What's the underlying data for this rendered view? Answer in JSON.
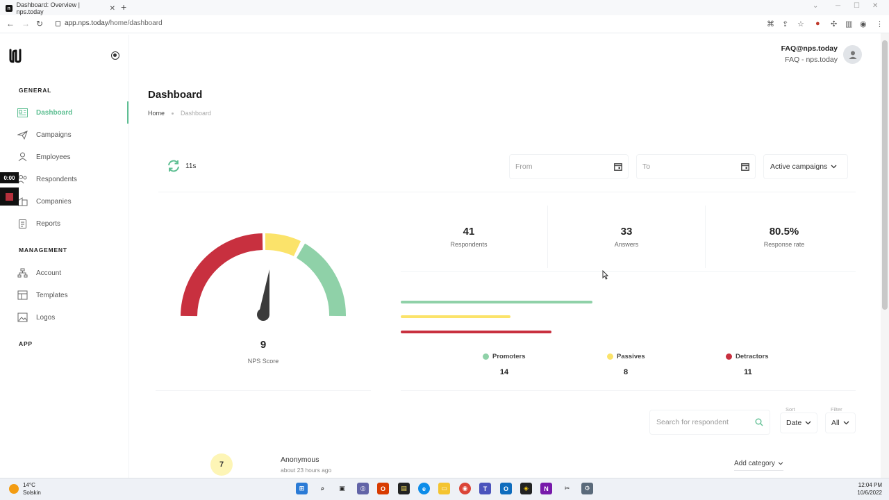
{
  "browser": {
    "tab_title": "Dashboard: Overview | nps.today",
    "url_domain": "app.nps.today",
    "url_path": "/home/dashboard"
  },
  "sidebar": {
    "general_title": "GENERAL",
    "management_title": "MANAGEMENT",
    "app_title": "APP",
    "general_items": [
      {
        "label": "Dashboard",
        "icon": "dashboard-icon",
        "active": true
      },
      {
        "label": "Campaigns",
        "icon": "paper-plane-icon"
      },
      {
        "label": "Employees",
        "icon": "person-icon"
      },
      {
        "label": "Respondents",
        "icon": "respondents-icon"
      },
      {
        "label": "Companies",
        "icon": "building-icon"
      },
      {
        "label": "Reports",
        "icon": "clipboard-icon"
      }
    ],
    "management_items": [
      {
        "label": "Account",
        "icon": "account-tree-icon"
      },
      {
        "label": "Templates",
        "icon": "templates-icon"
      },
      {
        "label": "Logos",
        "icon": "image-icon"
      }
    ]
  },
  "recorder": {
    "time": "0:00"
  },
  "user": {
    "email": "FAQ@nps.today",
    "org": "FAQ - nps.today"
  },
  "page": {
    "title": "Dashboard",
    "breadcrumb": [
      "Home",
      "Dashboard"
    ]
  },
  "filters": {
    "refresh_label": "11s",
    "from_placeholder": "From",
    "to_placeholder": "To",
    "campaign_select": "Active campaigns"
  },
  "stats": [
    {
      "value": "41",
      "label": "Respondents"
    },
    {
      "value": "33",
      "label": "Answers"
    },
    {
      "value": "80.5%",
      "label": "Response rate"
    }
  ],
  "nps": {
    "score": "9",
    "label": "NPS Score"
  },
  "breakdown": [
    {
      "name": "Promoters",
      "count": "14",
      "color": "#8fd1a8"
    },
    {
      "name": "Passives",
      "count": "8",
      "color": "#fbe36a"
    },
    {
      "name": "Detractors",
      "count": "11",
      "color": "#c8303f"
    }
  ],
  "list": {
    "search_placeholder": "Search for respondent",
    "sort_caption": "Sort",
    "sort_value": "Date",
    "filter_caption": "Filter",
    "filter_value": "All"
  },
  "respondent": {
    "score": "7",
    "name": "Anonymous",
    "time": "about 23 hours ago",
    "add_category": "Add category"
  },
  "taskbar": {
    "temp": "14°C",
    "location": "Solskin",
    "time": "12:04 PM",
    "date": "10/6/2022"
  }
}
